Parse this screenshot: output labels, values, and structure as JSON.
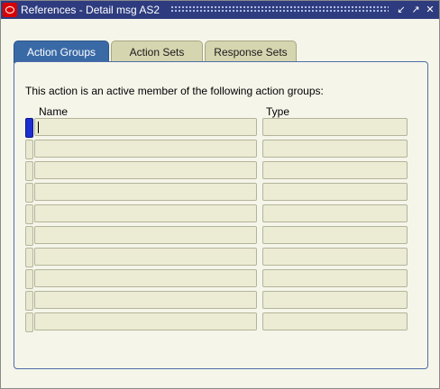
{
  "window": {
    "title": "References - Detail msg AS2",
    "controls": [
      "minimize-icon",
      "maximize-icon",
      "close-icon"
    ]
  },
  "tabs": [
    {
      "label": "Action Groups",
      "active": true
    },
    {
      "label": "Action Sets",
      "active": false
    },
    {
      "label": "Response Sets",
      "active": false
    }
  ],
  "panel": {
    "description": "This action is an active member of the following action groups:",
    "columns": {
      "name": "Name",
      "type": "Type"
    },
    "rows": [
      {
        "name": "",
        "type": ""
      },
      {
        "name": "",
        "type": ""
      },
      {
        "name": "",
        "type": ""
      },
      {
        "name": "",
        "type": ""
      },
      {
        "name": "",
        "type": ""
      },
      {
        "name": "",
        "type": ""
      },
      {
        "name": "",
        "type": ""
      },
      {
        "name": "",
        "type": ""
      },
      {
        "name": "",
        "type": ""
      },
      {
        "name": "",
        "type": ""
      }
    ]
  },
  "colors": {
    "titlebar": "#2e3c7f",
    "active_tab": "#3a6aa6",
    "inactive_tab": "#d5d5b0",
    "background": "#f5f5ea",
    "current_row_indicator": "#1c2fd0"
  }
}
